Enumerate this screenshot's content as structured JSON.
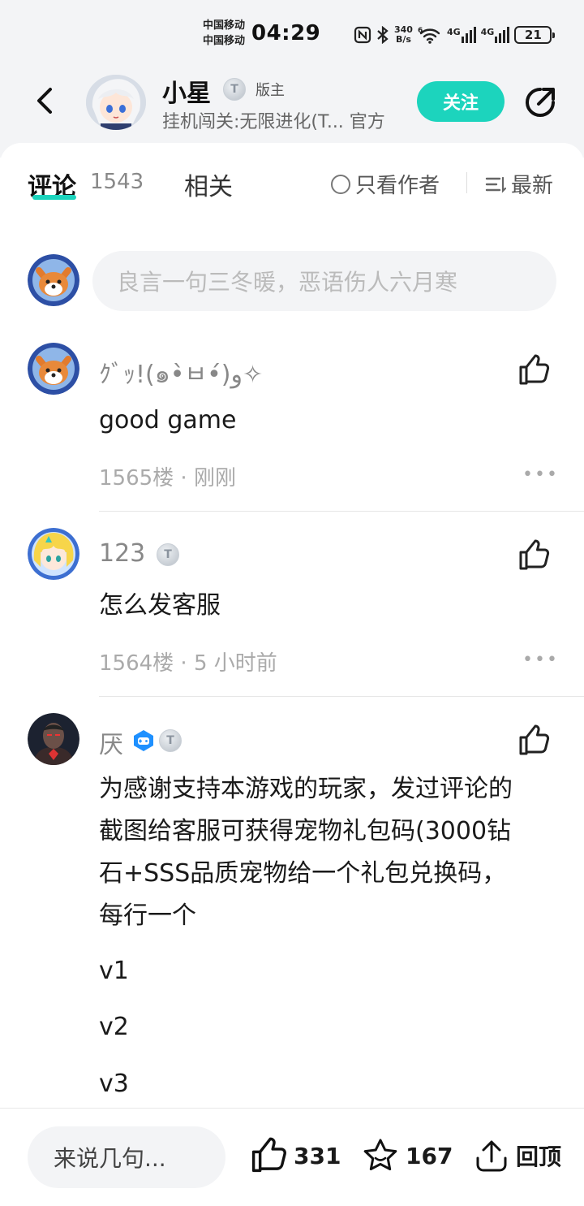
{
  "status": {
    "carrier1": "中国移动",
    "carrier2": "中国移动",
    "time": "04:29",
    "speed_top": "340",
    "speed_bottom": "B/s",
    "net1": "4G",
    "net2": "4G",
    "battery": "21"
  },
  "header": {
    "name": "小星",
    "role": "版主",
    "subtitle": "挂机闯关:无限进化(T... 官方",
    "follow_label": "关注",
    "badge_letter": "T"
  },
  "tabs": {
    "comments_label": "评论",
    "comments_count": "1543",
    "related_label": "相关",
    "only_author": "只看作者",
    "sort_label": "最新"
  },
  "composer": {
    "placeholder": "良言一句三冬暖，恶语伤人六月寒"
  },
  "comments": [
    {
      "name": "ｸﾞｯ!(๑•̀ㅂ•́)و✧",
      "text": "good game",
      "floor": "1565楼",
      "time": "刚刚"
    },
    {
      "name": "123",
      "text": "怎么发客服",
      "floor": "1564楼",
      "time": "5 小时前"
    },
    {
      "name": "厌",
      "lines": [
        "为感谢支持本游戏的玩家，发过评论的",
        "截图给客服可获得宠物礼包码(3000钻",
        "石+SSS品质宠物给一个礼包兑换码，",
        "每行一个"
      ],
      "codes": [
        "v1",
        "v2",
        "v3"
      ]
    }
  ],
  "bottom": {
    "say_label": "来说几句...",
    "likes": "331",
    "favorites": "167",
    "top_label": "回顶"
  },
  "colors": {
    "accent": "#1cd4bd",
    "header_bg": "#f3f4f6"
  }
}
